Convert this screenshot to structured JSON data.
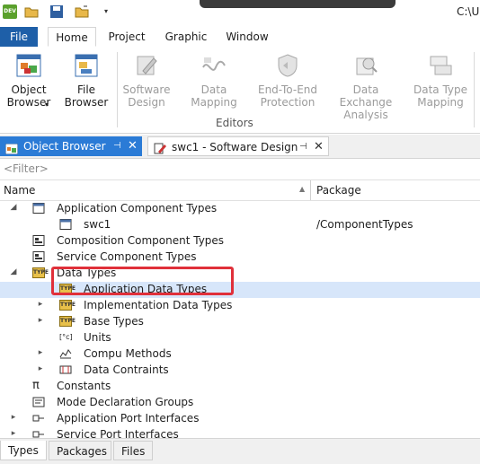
{
  "titlebar": {
    "title_fragment": "C:\\U",
    "qa_icons": [
      "dev-icon",
      "open-folder-icon",
      "save-icon",
      "folder-icon",
      "dropdown-icon"
    ],
    "qa_icon_label": "DEV"
  },
  "ribbon_tabs": [
    "File",
    "Home",
    "Project",
    "Graphic",
    "Window"
  ],
  "ribbon": {
    "object_browser": "Object\nBrowser",
    "file_browser": "File\nBrowser",
    "software_design": "Software\nDesign",
    "data_mapping": "Data Mapping",
    "end_to_end": "End-To-End\nProtection",
    "data_exchange": "Data Exchange\nAnalysis",
    "data_type_mapping": "Data Type\nMapping",
    "group_label": "Editors"
  },
  "doc_tabs": {
    "object_browser": "Object Browser",
    "swc": "swc1 - Software Design"
  },
  "filter": {
    "placeholder": "<Filter>"
  },
  "columns": {
    "name": "Name",
    "package": "Package"
  },
  "tree": [
    {
      "label": "Application Component Types",
      "package": "",
      "level": 1,
      "expander": "expanded",
      "icon": "application-component-icon"
    },
    {
      "label": "swc1",
      "package": "/ComponentTypes",
      "level": 2,
      "expander": "none",
      "icon": "component-instance-icon"
    },
    {
      "label": "Composition Component Types",
      "package": "",
      "level": 1,
      "expander": "none",
      "icon": "composition-icon"
    },
    {
      "label": "Service Component Types",
      "package": "",
      "level": 1,
      "expander": "none",
      "icon": "service-component-icon"
    },
    {
      "label": "Data Types",
      "package": "",
      "level": 1,
      "expander": "expanded",
      "icon": "type-icon"
    },
    {
      "label": "Application Data Types",
      "package": "",
      "level": 2,
      "expander": "none",
      "icon": "type-icon",
      "selected": true
    },
    {
      "label": "Implementation Data Types",
      "package": "",
      "level": 2,
      "expander": "collapsed",
      "icon": "type-icon"
    },
    {
      "label": "Base Types",
      "package": "",
      "level": 2,
      "expander": "collapsed",
      "icon": "type-icon"
    },
    {
      "label": "Units",
      "package": "",
      "level": 2,
      "expander": "none",
      "icon": "units-icon"
    },
    {
      "label": "Compu Methods",
      "package": "",
      "level": 2,
      "expander": "collapsed",
      "icon": "compu-method-icon"
    },
    {
      "label": "Data Contraints",
      "package": "",
      "level": 2,
      "expander": "collapsed",
      "icon": "data-constraint-icon"
    },
    {
      "label": "Constants",
      "package": "",
      "level": 1,
      "expander": "none",
      "icon": "pi-icon"
    },
    {
      "label": "Mode Declaration Groups",
      "package": "",
      "level": 1,
      "expander": "none",
      "icon": "mode-group-icon"
    },
    {
      "label": "Application Port Interfaces",
      "package": "",
      "level": 1,
      "expander": "collapsed",
      "icon": "port-interface-icon"
    },
    {
      "label": "Service Port Interfaces",
      "package": "",
      "level": 1,
      "expander": "collapsed",
      "icon": "port-interface-icon"
    }
  ],
  "bottom_tabs": [
    "Types",
    "Packages",
    "Files"
  ],
  "icons": {
    "type_glyph": "TYPE",
    "units_glyph": "[°c]",
    "pi_glyph": "π"
  },
  "colors": {
    "file_tab": "#1e5fa8",
    "active_doc_tab": "#2b7bd6",
    "selection": "#d7e6fa",
    "highlight_box": "#e0303a"
  }
}
